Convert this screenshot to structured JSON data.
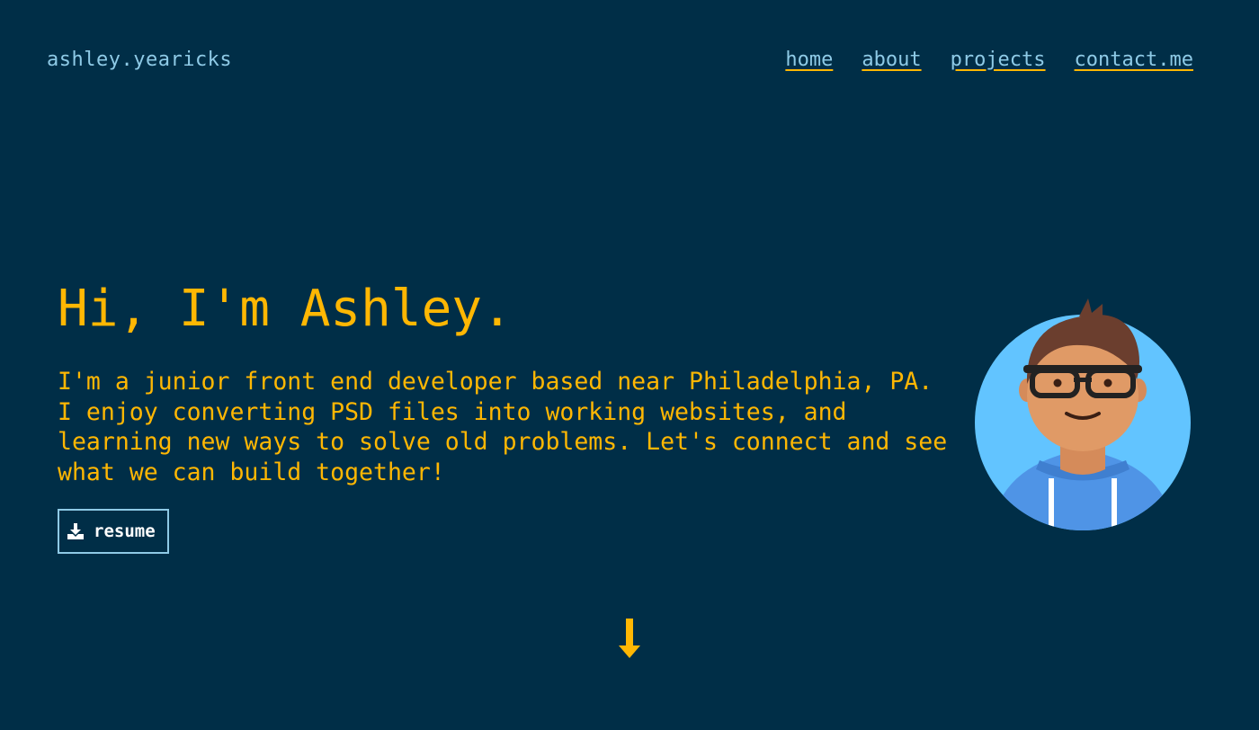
{
  "header": {
    "brand": "ashley.yearicks",
    "nav": [
      {
        "label": "home"
      },
      {
        "label": "about"
      },
      {
        "label": "projects"
      },
      {
        "label": "contact.me"
      }
    ]
  },
  "hero": {
    "title": "Hi, I'm Ashley.",
    "description": "I'm a junior front end developer based near Philadelphia, PA. I enjoy converting PSD files into working websites, and learning new ways to solve old problems. Let's connect and see what we can build together!",
    "resume_label": "resume"
  },
  "icons": {
    "resume": "download-icon",
    "avatar": "avatar-illustration",
    "scroll": "arrow-down-icon"
  },
  "colors": {
    "background": "#002e47",
    "accent": "#ffb703",
    "link": "#8ecae6",
    "avatar_circle": "#62c4ff"
  }
}
